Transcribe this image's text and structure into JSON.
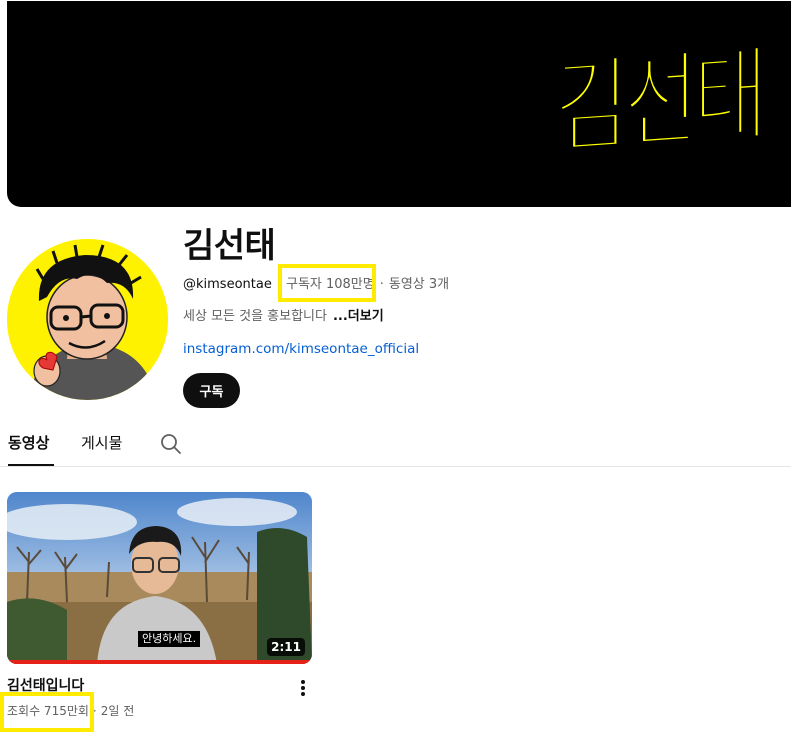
{
  "banner": {
    "logo_text": "김선태",
    "logo_color": "#ffff00"
  },
  "channel": {
    "name": "김선태",
    "handle": "@kimseontae",
    "separator": "·",
    "subscribers": "구독자 108만명",
    "video_count": "동영상 3개",
    "description": "세상 모든 것을 홍보합니다",
    "more_label": "...더보기",
    "link": "instagram.com/kimseontae_official",
    "subscribe_label": "구독"
  },
  "tabs": {
    "videos": "동영상",
    "posts": "게시물",
    "search_icon": "search-icon"
  },
  "video": {
    "title": "김선태입니다",
    "views": "조회수 715만회",
    "age": "2일 전",
    "duration": "2:11",
    "caption": "안녕하세요.",
    "menu_icon": "more-vert-icon"
  },
  "highlight_color": "#ffeb00"
}
